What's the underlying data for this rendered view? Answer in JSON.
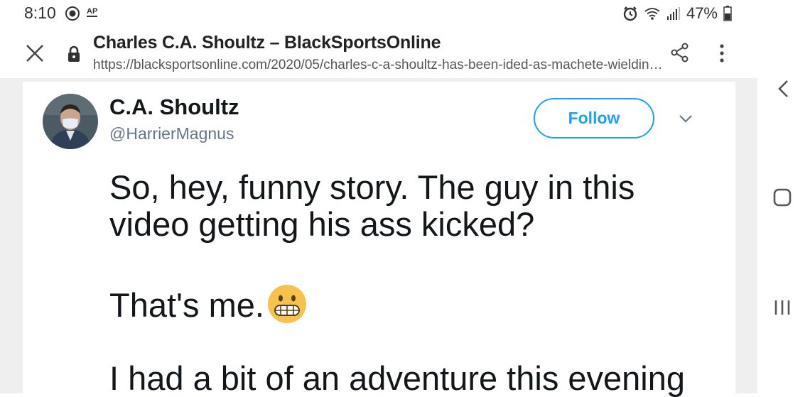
{
  "status_bar": {
    "time": "8:10",
    "ap_label": "AP",
    "battery": "47%",
    "icons": [
      "eye-icon",
      "alarm-icon",
      "wifi-icon",
      "signal-icon",
      "battery-icon"
    ]
  },
  "browser": {
    "title": "Charles C.A. Shoultz – BlackSportsOnline",
    "url": "https://blacksportsonline.com/2020/05/charles-c-a-shoultz-has-been-ided-as-machete-wielding-man...",
    "icons": [
      "close-icon",
      "lock-icon",
      "share-icon",
      "more-vert-icon"
    ]
  },
  "tweet": {
    "display_name": "C.A. Shoultz",
    "handle": "@HarrierMagnus",
    "follow_label": "Follow",
    "lines": [
      "So, hey, funny story. The guy in this",
      "video getting his ass kicked?",
      "That's me.",
      "I had a bit of an adventure this evening"
    ],
    "emoji": "grimacing-face-emoji"
  },
  "nav": {
    "icons": [
      "back-chevron-icon",
      "home-icon",
      "recents-icon"
    ]
  },
  "colors": {
    "accent": "#1da1f2",
    "text": "#14171a",
    "muted": "#657786",
    "page_bg": "#efefef"
  }
}
